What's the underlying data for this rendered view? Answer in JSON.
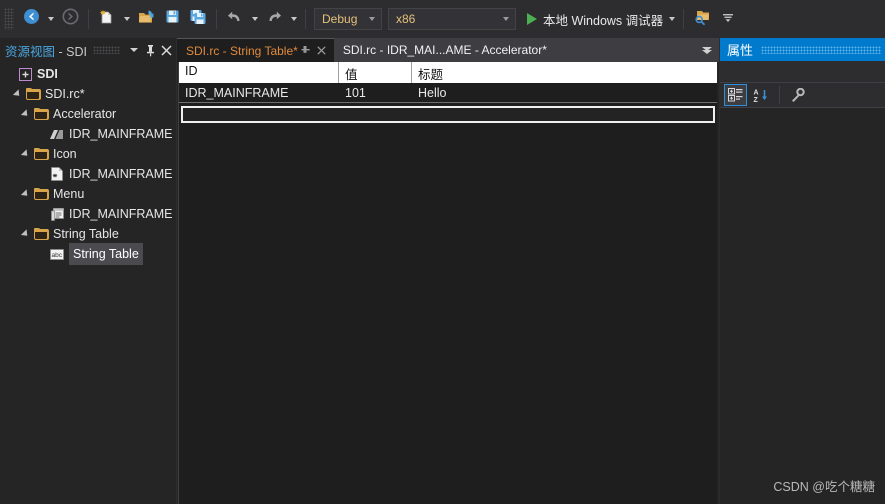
{
  "toolbar": {
    "nav_back_icon": "navigate-back-icon",
    "nav_forward_icon": "navigate-forward-icon",
    "new_item_icon": "new-item-icon",
    "open_file_icon": "open-file-icon",
    "save_icon": "save-icon",
    "save_all_icon": "save-all-icon",
    "undo_icon": "undo-icon",
    "redo_icon": "redo-icon",
    "find_in_files_icon": "find-in-files-icon",
    "overflow_icon": "toolbar-overflow-icon",
    "configuration": "Debug",
    "platform": "x86",
    "run_label": "本地 Windows 调试器"
  },
  "resource_view": {
    "title_primary": "资源视图",
    "title_secondary": " - SDI",
    "dropdown_icon": "chevron-down-icon",
    "pin_icon": "pin-icon",
    "close_icon": "close-icon",
    "tree": [
      {
        "label": "SDI",
        "indent": 0,
        "icon": "solution-icon",
        "expander": "",
        "bold": true,
        "selected": false
      },
      {
        "label": "SDI.rc*",
        "indent": 1,
        "icon": "folder-icon",
        "expander": "expanded",
        "bold": false,
        "selected": false
      },
      {
        "label": "Accelerator",
        "indent": 2,
        "icon": "folder-icon",
        "expander": "expanded",
        "bold": false,
        "selected": false
      },
      {
        "label": "IDR_MAINFRAME",
        "indent": 4,
        "icon": "accelerator-icon",
        "expander": "",
        "bold": false,
        "selected": false
      },
      {
        "label": "Icon",
        "indent": 2,
        "icon": "folder-icon",
        "expander": "expanded",
        "bold": false,
        "selected": false
      },
      {
        "label": "IDR_MAINFRAME",
        "indent": 4,
        "icon": "icon-resource-icon",
        "expander": "",
        "bold": false,
        "selected": false
      },
      {
        "label": "Menu",
        "indent": 2,
        "icon": "folder-icon",
        "expander": "expanded",
        "bold": false,
        "selected": false
      },
      {
        "label": "IDR_MAINFRAME",
        "indent": 4,
        "icon": "menu-resource-icon",
        "expander": "",
        "bold": false,
        "selected": false
      },
      {
        "label": "String Table",
        "indent": 2,
        "icon": "folder-icon",
        "expander": "expanded",
        "bold": false,
        "selected": false
      },
      {
        "label": "String Table",
        "indent": 4,
        "icon": "string-table-icon",
        "expander": "",
        "bold": false,
        "selected": true
      }
    ]
  },
  "editor": {
    "tabs": [
      {
        "label": "SDI.rc - String Table*",
        "active": true,
        "pinnable": true,
        "closable": true
      },
      {
        "label": "SDI.rc - IDR_MAI...AME - Accelerator*",
        "active": false,
        "pinnable": false,
        "closable": false
      }
    ],
    "tab_overflow_icon": "tab-overflow-icon",
    "string_table": {
      "columns": [
        "ID",
        "值",
        "标题"
      ],
      "rows": [
        {
          "id": "IDR_MAINFRAME",
          "value": "101",
          "caption": "Hello"
        }
      ],
      "new_row_value": "",
      "new_row_placeholder": ""
    }
  },
  "properties": {
    "title": "属性",
    "categorized_icon": "categorized-view-icon",
    "alphabetical_icon": "alphabetical-sort-icon",
    "property_pages_icon": "property-pages-icon"
  },
  "watermark": "CSDN @吃个糖糖",
  "colors": {
    "accent": "#007acc",
    "tab_active_text": "#e08a3c",
    "run_play": "#4caf50",
    "folder": "#d8a44a",
    "combo_text": "#e4c07a"
  }
}
